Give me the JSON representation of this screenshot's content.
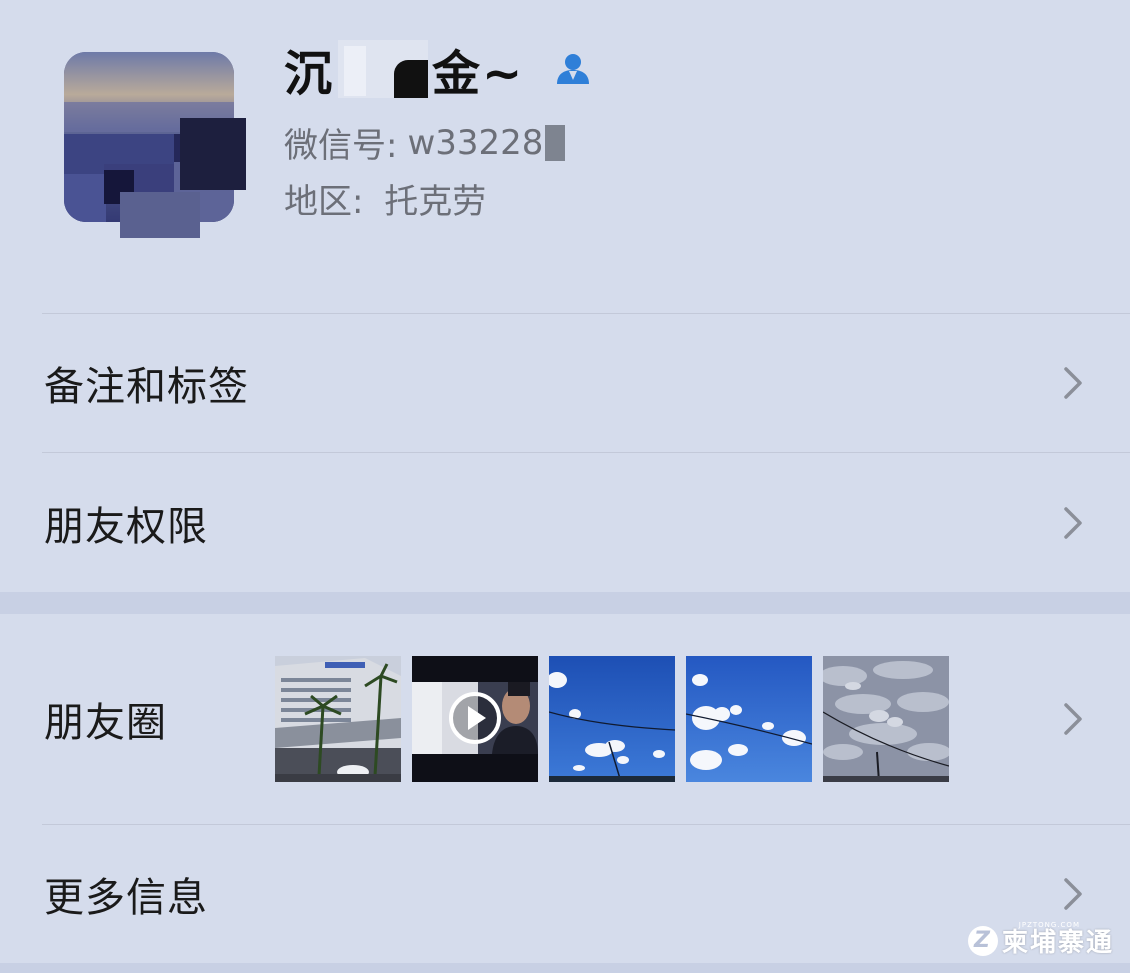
{
  "profile": {
    "nickname_start": "沉",
    "nickname_end": "金~",
    "wechat_id_label": "微信号:",
    "wechat_id_value": "w33228",
    "region_label": "地区:",
    "region_value": "托克劳",
    "icon": "contact-person-icon",
    "icon_color": "#2f7fd8"
  },
  "menu": {
    "remark_tags": "备注和标签",
    "friend_permissions": "朋友权限",
    "moments": "朋友圈",
    "more_info": "更多信息"
  },
  "moments_thumbnails": [
    {
      "icon": "building-photo"
    },
    {
      "icon": "video-play-icon"
    },
    {
      "icon": "sky-photo"
    },
    {
      "icon": "sky-photo"
    },
    {
      "icon": "cloudy-sky-photo"
    }
  ],
  "watermark": {
    "text": "柬埔寨通",
    "small_text": "JPZTONG.COM"
  },
  "colors": {
    "background": "#d5dcec",
    "divider": "#c3c9d9",
    "section_gap": "#c8d0e4",
    "secondary_text": "#6c6f78",
    "chevron": "#8b8f99"
  }
}
